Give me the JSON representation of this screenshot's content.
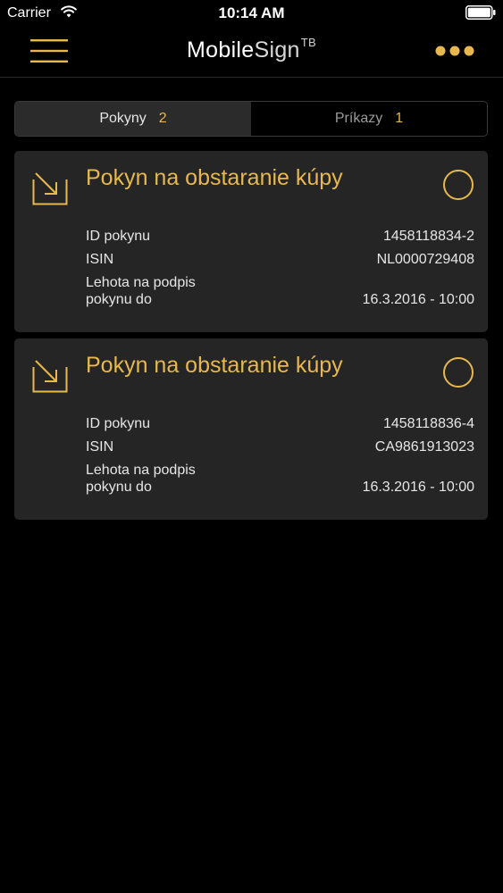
{
  "status_bar": {
    "carrier": "Carrier",
    "time": "10:14 AM",
    "icons": [
      "wifi-icon",
      "battery-icon"
    ]
  },
  "nav": {
    "title_bold": "Mobile",
    "title_thin": "Sign",
    "title_sup": "TB",
    "icons": [
      "menu-icon",
      "more-icon"
    ]
  },
  "tabs": [
    {
      "label": "Pokyny",
      "count": "2",
      "active": true
    },
    {
      "label": "Príkazy",
      "count": "1",
      "active": false
    }
  ],
  "cards": [
    {
      "title": "Pokyn na obstaranie kúpy",
      "icon": "incoming-arrow-icon",
      "rows": [
        {
          "label": "ID pokynu",
          "value": "1458118834-2"
        },
        {
          "label": "ISIN",
          "value": "NL0000729408"
        },
        {
          "label": "Lehota na podpis pokynu do",
          "value": "16.3.2016 - 10:00"
        }
      ]
    },
    {
      "title": "Pokyn na obstaranie kúpy",
      "icon": "incoming-arrow-icon",
      "rows": [
        {
          "label": "ID pokynu",
          "value": "1458118836-4"
        },
        {
          "label": "ISIN",
          "value": "CA9861913023"
        },
        {
          "label": "Lehota na podpis pokynu do",
          "value": "16.3.2016 - 10:00"
        }
      ]
    }
  ],
  "colors": {
    "accent": "#e6b84f",
    "card_bg": "#252525",
    "background": "#000000",
    "text": "#e6e6e6"
  }
}
